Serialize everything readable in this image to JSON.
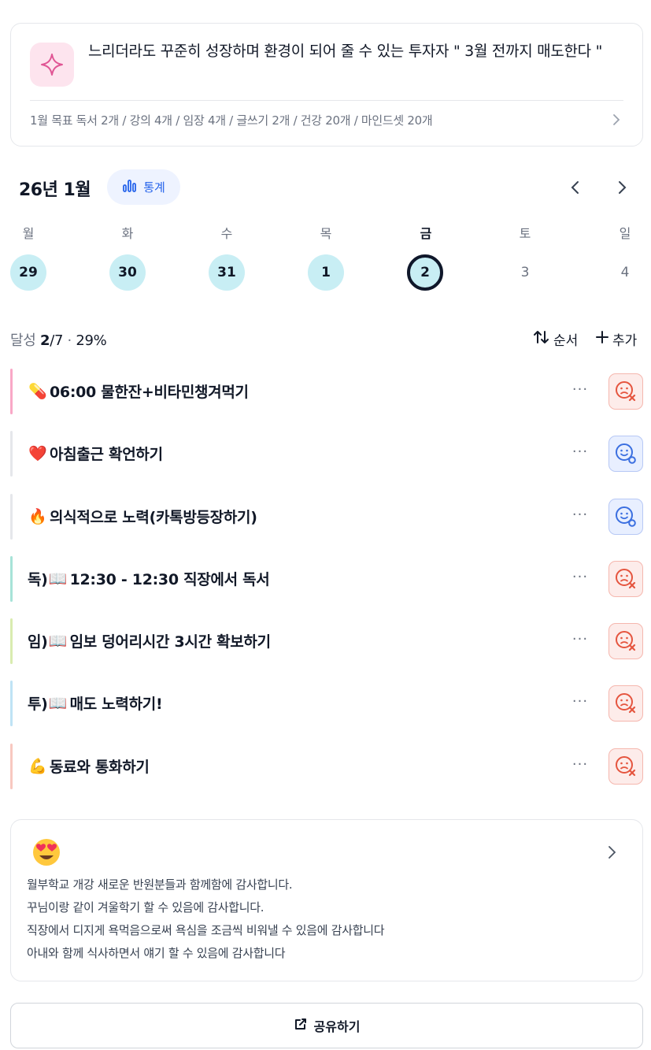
{
  "goal": {
    "text": "느리더라도 꾸준히 성장하며 환경이 되어 줄 수 있는 투자자 \" 3월 전까지 매도한다 \"",
    "month_goal": "1월 목표  독서 2개 / 강의 4개 / 임장 4개 / 글쓰기 2개 / 건강 20개 / 마인드셋 20개",
    "icon": "sparkle-icon"
  },
  "calendar": {
    "title": "26년 1월",
    "stats_label": "통계",
    "weekdays": [
      "월",
      "화",
      "수",
      "목",
      "금",
      "토",
      "일"
    ],
    "days": [
      "29",
      "30",
      "31",
      "1",
      "2",
      "3",
      "4"
    ]
  },
  "progress": {
    "label": "달성",
    "done": "2",
    "total": "/7",
    "sep": " · ",
    "percent": "29%"
  },
  "actions": {
    "order_label": "순서",
    "add_label": "추가"
  },
  "habits": [
    {
      "emoji": "💊",
      "text": "06:00 물한잔+비타민챙겨먹기",
      "status": "fail",
      "accent": "#f9a8c7"
    },
    {
      "emoji": "❤️",
      "text": "아침출근 확언하기",
      "status": "ok",
      "accent": "#e5e7eb"
    },
    {
      "emoji": "🔥",
      "text": "의식적으로 노력(카톡방등장하기)",
      "status": "ok",
      "accent": "#e5e7eb"
    },
    {
      "emoji": "📖",
      "prefix": "독)",
      "text": "12:30 - 12:30 직장에서 독서",
      "status": "fail",
      "accent": "#a7e3d8"
    },
    {
      "emoji": "📖",
      "prefix": "임)",
      "text": "임보 덩어리시간 3시간 확보하기",
      "status": "fail",
      "accent": "#d9ecb0"
    },
    {
      "emoji": "📖",
      "prefix": "투)",
      "text": "매도 노력하기!",
      "status": "fail",
      "accent": "#bfe3f5"
    },
    {
      "emoji": "💪",
      "text": "동료와 통화하기",
      "status": "fail",
      "accent": "#f8c8c0"
    }
  ],
  "gratitude": {
    "emoji": "😍",
    "lines": [
      "월부학교 개강 새로운 반원분들과 함께함에 감사합니다.",
      "꾸님이랑 같이 겨울학기 할 수 있음에 감사합니다.",
      "직장에서 디지게 욕먹음으로써 욕심을 조금씩 비워낼 수 있음에 감사합니다",
      "아내와 함께 식사하면서 얘기 할 수 있음에 감사합니다"
    ]
  },
  "share": {
    "label": "공유하기"
  },
  "colors": {
    "done_day": "#c8eef4",
    "accent_blue": "#2563eb",
    "fail_red": "#e5553f",
    "ok_blue": "#3b6fe0"
  }
}
